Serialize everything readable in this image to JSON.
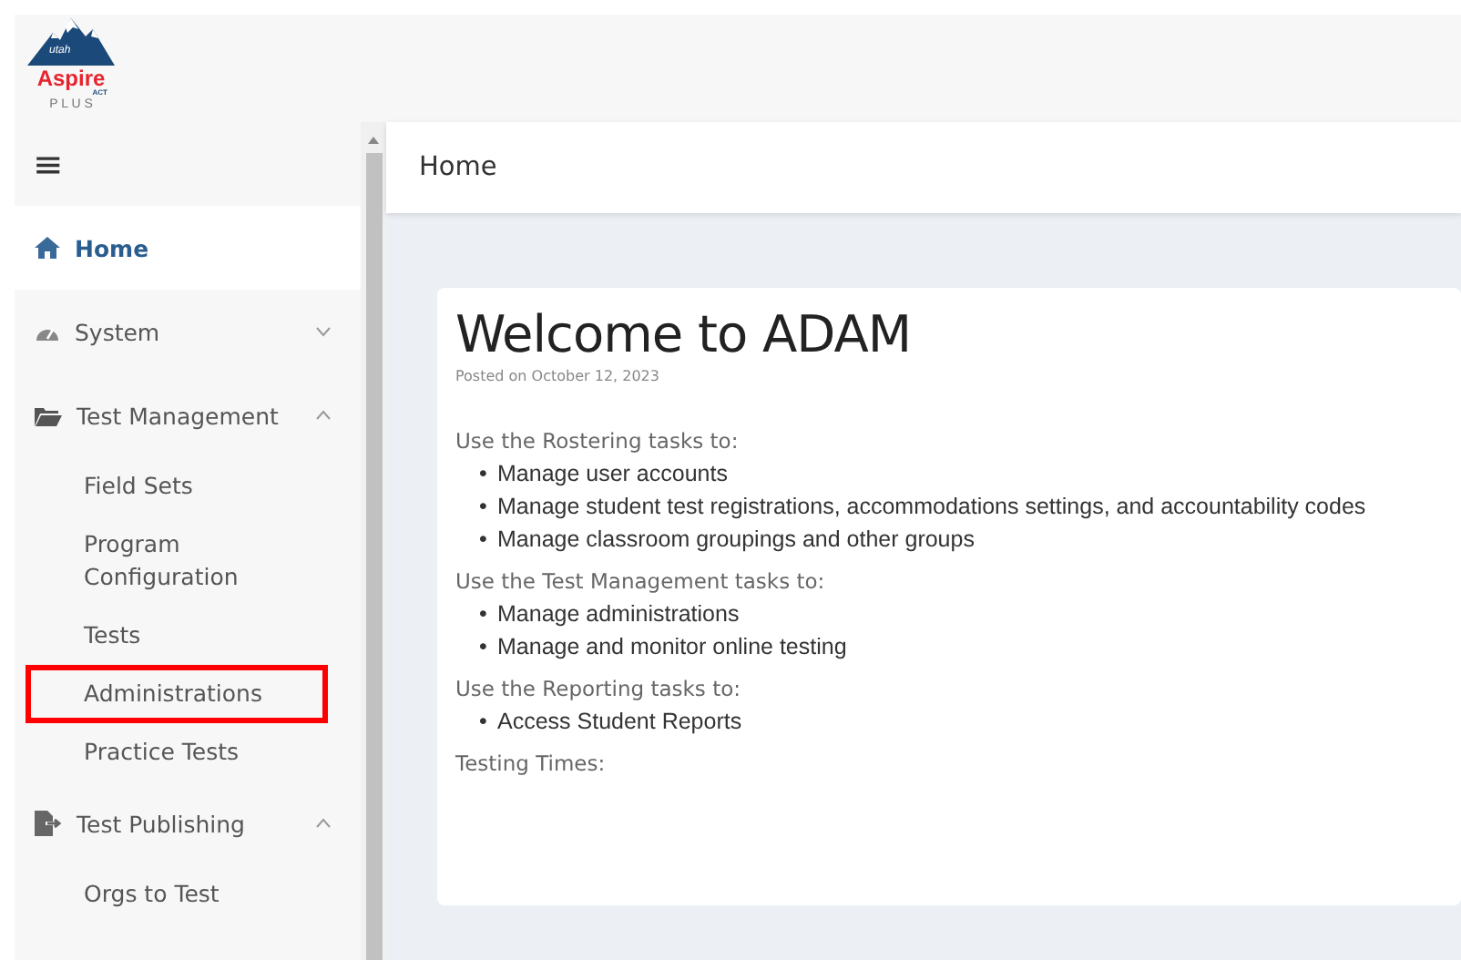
{
  "logo": {
    "region": "utah",
    "name": "Aspire",
    "brand": "ACT",
    "tagline": "P L U S"
  },
  "sidebar": {
    "menu_icon": "≡",
    "items": [
      {
        "label": "Home",
        "selected": true
      },
      {
        "label": "System",
        "selected": false,
        "expanded": false
      },
      {
        "label": "Test Management",
        "selected": false,
        "expanded": true,
        "children": [
          {
            "label": "Field Sets",
            "selected": false,
            "highlighted": false
          },
          {
            "label": "Program Configuration",
            "selected": false,
            "highlighted": false
          },
          {
            "label": "Tests",
            "selected": false,
            "highlighted": false
          },
          {
            "label": "Administrations",
            "selected": false,
            "highlighted": true
          },
          {
            "label": "Practice Tests",
            "selected": false,
            "highlighted": false
          }
        ]
      },
      {
        "label": "Test Publishing",
        "selected": false,
        "expanded": true,
        "children": [
          {
            "label": "Orgs to Test",
            "selected": false,
            "highlighted": false
          }
        ]
      }
    ]
  },
  "page": {
    "title": "Home"
  },
  "post": {
    "title": "Welcome to ADAM",
    "posted": "Posted on October 12, 2023",
    "sections": [
      {
        "heading": "Use the Rostering tasks to:",
        "items": [
          {
            "bullet": "•",
            "text": "Manage user accounts"
          },
          {
            "bullet": "•",
            "text": "Manage student test registrations, accommodations settings, and accountability codes"
          },
          {
            "bullet": "•",
            "text": "Manage classroom groupings and other groups"
          }
        ]
      },
      {
        "heading": "Use the Test Management tasks to:",
        "items": [
          {
            "bullet": "•",
            "text": "Manage administrations"
          },
          {
            "bullet": "•",
            "text": "Manage and monitor online testing"
          }
        ]
      },
      {
        "heading": "Use the Reporting tasks to:",
        "items": [
          {
            "bullet": "•",
            "text": "Access Student Reports"
          }
        ]
      },
      {
        "heading": "Testing Times:"
      }
    ]
  }
}
